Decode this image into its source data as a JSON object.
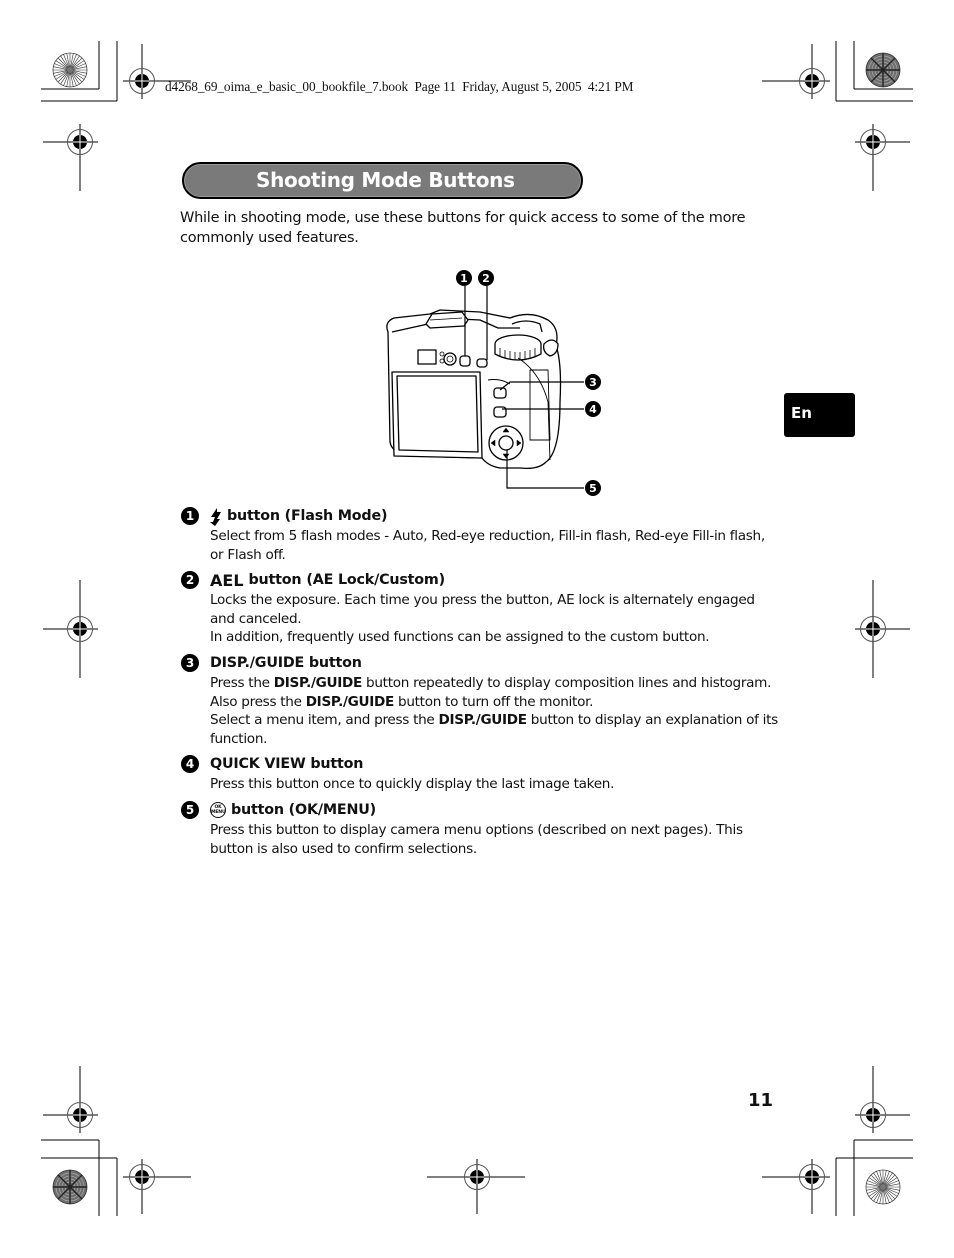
{
  "print_header": {
    "text": "d4268_69_oima_e_basic_00_bookfile_7.book  Page 11  Friday, August 5, 2005  4:21 PM"
  },
  "section": {
    "title": "Shooting Mode Buttons",
    "intro": "While in shooting mode, use these buttons for quick access to some of the more commonly used features."
  },
  "language_tab": {
    "label": "En"
  },
  "figure": {
    "subject": "camera-rear-view",
    "callouts": [
      "1",
      "2",
      "3",
      "4",
      "5"
    ]
  },
  "items": [
    {
      "number": "1",
      "icon": "flash-icon",
      "heading": "button (Flash Mode)",
      "paragraphs": [
        "Select from 5 flash modes - Auto, Red-eye reduction, Fill-in flash, Red-eye Fill-in flash, or Flash off."
      ]
    },
    {
      "number": "2",
      "symbol": "AEL",
      "heading_pre": "button",
      "heading_paren": "(AE Lock/Custom)",
      "paragraphs": [
        "Locks the exposure. Each time you press the button, AE lock is alternately engaged and canceled.",
        "In addition, frequently used functions can be assigned to the custom button."
      ]
    },
    {
      "number": "3",
      "heading": "DISP./GUIDE button",
      "bold_term": "DISP./GUIDE",
      "paragraphs": [
        {
          "pre": "Press the ",
          "post": " button repeatedly to display composition lines and histogram."
        },
        {
          "pre": "Also press the ",
          "post": " button to turn off the monitor."
        },
        {
          "pre": "Select a menu item, and press the ",
          "post": " button to display an explanation of its function."
        }
      ]
    },
    {
      "number": "4",
      "heading": "QUICK VIEW button",
      "paragraphs": [
        "Press this button once to quickly display the last image taken."
      ]
    },
    {
      "number": "5",
      "icon": "ok-menu-icon",
      "icon_text_top": "OK",
      "icon_text_bottom": "MENU",
      "heading": "button (OK/MENU)",
      "paragraphs": [
        "Press this button to display camera menu options (described on next pages). This button is also used to confirm selections."
      ]
    }
  ],
  "page_number": "11"
}
